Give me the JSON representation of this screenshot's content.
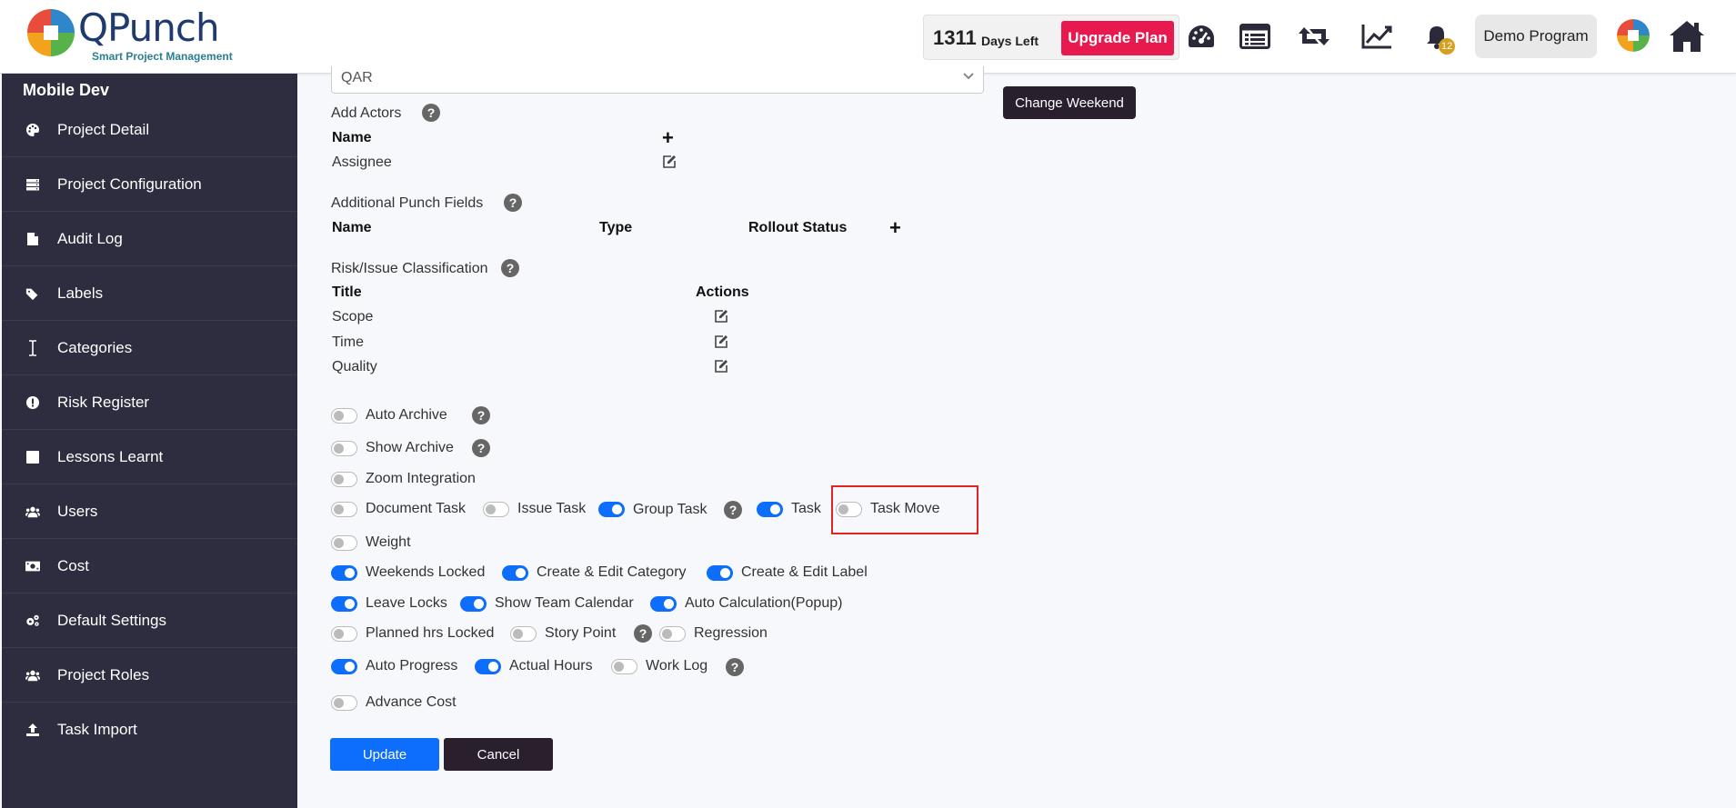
{
  "header": {
    "logo_text": "QPunch",
    "logo_subtitle": "Smart Project Management",
    "days_left_number": "1311",
    "days_left_label": "Days Left",
    "upgrade_label": "Upgrade Plan",
    "notification_count": "12",
    "program_label": "Demo Program",
    "icons": [
      "dashboard-icon",
      "list-icon",
      "retweet-icon",
      "chart-line-icon",
      "bell-icon",
      "home-icon"
    ]
  },
  "sidebar": {
    "title": "Mobile Dev",
    "items": [
      {
        "label": "Project Detail",
        "icon": "palette-icon"
      },
      {
        "label": "Project Configuration",
        "icon": "server-icon"
      },
      {
        "label": "Audit Log",
        "icon": "file-icon"
      },
      {
        "label": "Labels",
        "icon": "tags-icon"
      },
      {
        "label": "Categories",
        "icon": "i-cursor-icon"
      },
      {
        "label": "Risk Register",
        "icon": "exclamation-circle-icon"
      },
      {
        "label": "Lessons Learnt",
        "icon": "square-icon"
      },
      {
        "label": "Users",
        "icon": "users-icon"
      },
      {
        "label": "Cost",
        "icon": "money-bill-icon"
      },
      {
        "label": "Default Settings",
        "icon": "cogs-icon"
      },
      {
        "label": "Project Roles",
        "icon": "users-icon"
      },
      {
        "label": "Task Import",
        "icon": "upload-icon"
      }
    ]
  },
  "form": {
    "select_value": "QAR",
    "change_weekend_label": "Change Weekend",
    "add_actors": {
      "title": "Add Actors",
      "col_name": "Name",
      "rows": [
        "Assignee"
      ]
    },
    "additional_fields": {
      "title": "Additional Punch Fields",
      "col_name": "Name",
      "col_type": "Type",
      "col_rollout": "Rollout Status"
    },
    "risk_classification": {
      "title": "Risk/Issue Classification",
      "col_title": "Title",
      "col_actions": "Actions",
      "rows": [
        "Scope",
        "Time",
        "Quality"
      ]
    },
    "toggles": {
      "auto_archive": {
        "label": "Auto Archive",
        "on": false
      },
      "show_archive": {
        "label": "Show Archive",
        "on": false
      },
      "zoom_integration": {
        "label": "Zoom Integration",
        "on": false
      },
      "document_task": {
        "label": "Document Task",
        "on": false
      },
      "issue_task": {
        "label": "Issue Task",
        "on": false
      },
      "group_task": {
        "label": "Group Task",
        "on": true
      },
      "task": {
        "label": "Task",
        "on": true
      },
      "task_move": {
        "label": "Task Move",
        "on": false
      },
      "weight": {
        "label": "Weight",
        "on": false
      },
      "weekends_locked": {
        "label": "Weekends Locked",
        "on": true
      },
      "create_edit_category": {
        "label": "Create & Edit Category",
        "on": true
      },
      "create_edit_label": {
        "label": "Create & Edit Label",
        "on": true
      },
      "leave_locks": {
        "label": "Leave Locks",
        "on": true
      },
      "show_team_calendar": {
        "label": "Show Team Calendar",
        "on": true
      },
      "auto_calculation": {
        "label": "Auto Calculation(Popup)",
        "on": true
      },
      "planned_hrs_locked": {
        "label": "Planned hrs Locked",
        "on": false
      },
      "story_point": {
        "label": "Story Point",
        "on": false
      },
      "regression": {
        "label": "Regression",
        "on": false
      },
      "auto_progress": {
        "label": "Auto Progress",
        "on": true
      },
      "actual_hours": {
        "label": "Actual Hours",
        "on": true
      },
      "work_log": {
        "label": "Work Log",
        "on": false
      },
      "advance_cost": {
        "label": "Advance Cost",
        "on": false
      }
    },
    "update_label": "Update",
    "cancel_label": "Cancel",
    "help_glyph": "?"
  },
  "colors": {
    "sidebar_bg": "#2d2d3f",
    "primary": "#0d6efd",
    "upgrade": "#e8194e",
    "dark_button": "#2a1f2d",
    "highlight": "#e02424"
  }
}
